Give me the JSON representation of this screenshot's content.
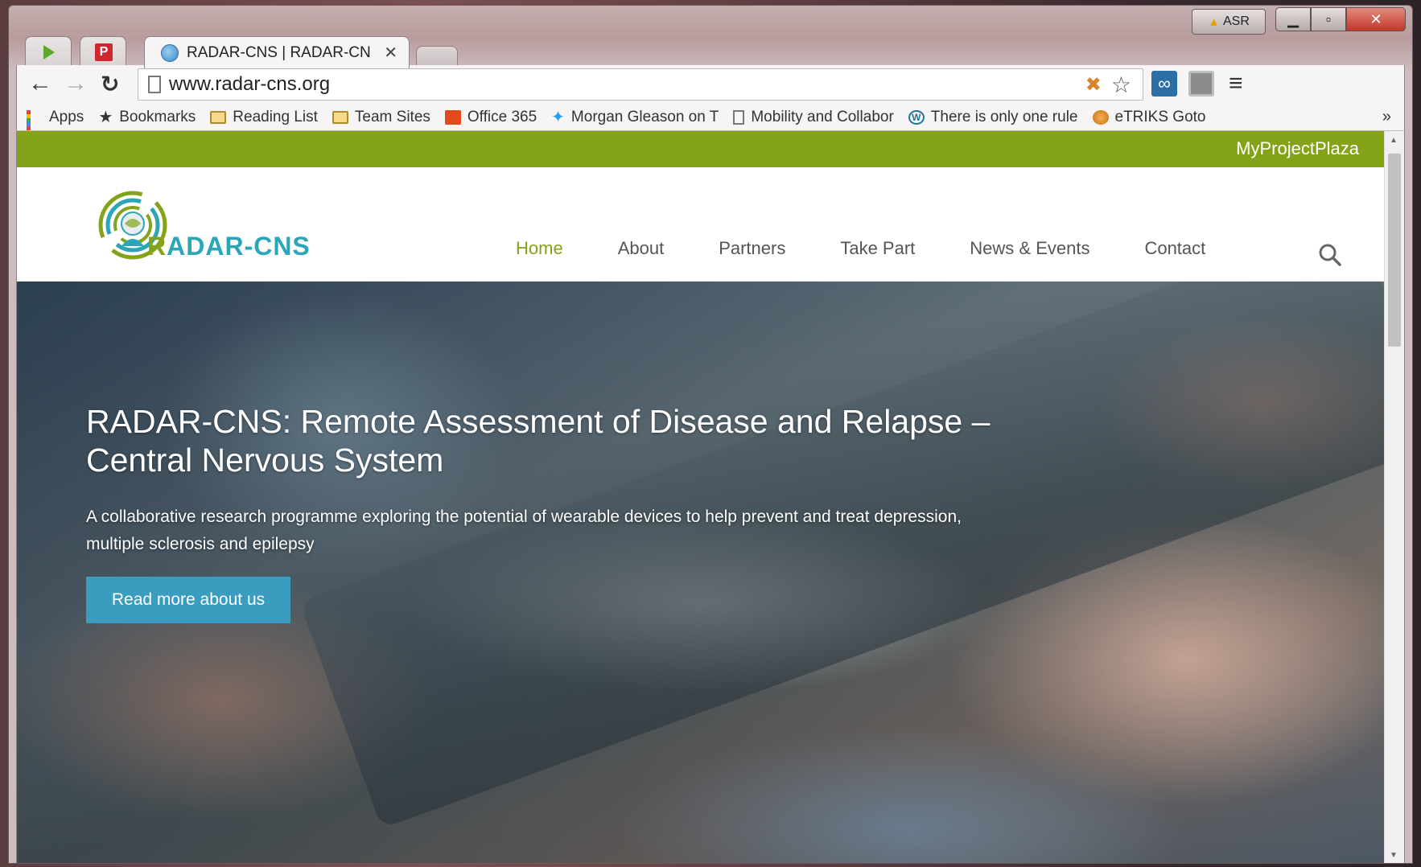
{
  "window": {
    "asr_label": "ASR",
    "tabs": [
      {
        "icon": "play-icon"
      },
      {
        "icon": "p-icon",
        "label": "P"
      },
      {
        "title": "RADAR-CNS | RADAR-CN",
        "icon": "globe-icon"
      }
    ]
  },
  "toolbar": {
    "url": "www.radar-cns.org"
  },
  "bookmarks": [
    {
      "label": "Apps",
      "icon": "apps-icon"
    },
    {
      "label": "Bookmarks",
      "icon": "star-icon"
    },
    {
      "label": "Reading List",
      "icon": "folder-icon"
    },
    {
      "label": "Team Sites",
      "icon": "folder-icon"
    },
    {
      "label": "Office 365",
      "icon": "office365-icon"
    },
    {
      "label": "Morgan Gleason on T",
      "icon": "twitter-icon"
    },
    {
      "label": "Mobility and Collabor",
      "icon": "page-icon"
    },
    {
      "label": "There is only one rule",
      "icon": "wordpress-icon"
    },
    {
      "label": "eTRIKS Goto",
      "icon": "etriks-icon"
    }
  ],
  "site": {
    "topbar_link": "MyProjectPlaza",
    "logo_text_first": "R",
    "logo_text_rest": "ADAR-CNS",
    "nav": [
      "Home",
      "About",
      "Partners",
      "Take Part",
      "News & Events",
      "Contact"
    ],
    "active_nav": "Home",
    "hero": {
      "title": "RADAR-CNS: Remote Assessment of Disease and Relapse – Central Nervous System",
      "subtitle": "A collaborative research programme exploring the potential of wearable devices to help prevent and treat depression, multiple sclerosis and epilepsy",
      "button": "Read more about us"
    }
  },
  "colors": {
    "brand_green": "#84a318",
    "brand_teal": "#2aa6b8",
    "button_blue": "#3a9dbf"
  }
}
